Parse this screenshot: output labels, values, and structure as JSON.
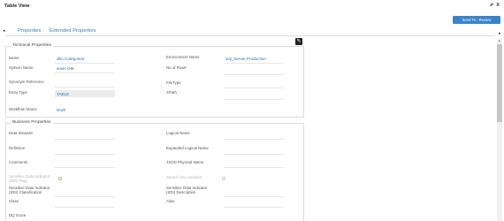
{
  "window": {
    "title": "Table View",
    "maximize_glyph": "⇗",
    "close_glyph": "X"
  },
  "toolbar": {
    "send_label": "Send To - Review"
  },
  "tabs": [
    {
      "label": "Properties",
      "active": true
    },
    {
      "label": "Extended Properties",
      "active": false
    }
  ],
  "icons": {
    "edit": "edit-icon",
    "checkbox_glyph": "✓"
  },
  "technical": {
    "title": "Technical Properties",
    "name_label": "Name",
    "name_value": "dbo.Categories",
    "system_name_label": "System Name",
    "system_name_value": "erwin DM",
    "synonym_label": "Synonym Reference",
    "entry_type_label": "Entry Type",
    "entry_type_value": "TABLE",
    "workflow_label": "Workflow Status",
    "workflow_value": "Draft",
    "env_label": "Environment Name",
    "env_value": "Sql_Server Production",
    "rows_label": "No of Rows",
    "filetype_label": "FileType",
    "xpath_label": "XPath"
  },
  "business": {
    "title": "Business Properties",
    "steward_label": "Data Steward",
    "definition_label": "Definition",
    "comments_label": "Comments",
    "sdi_flag_label": "Sensitive Data Indicator (SDI) Flag",
    "sdi_class_label": "Sensitive Data Indicator (SDI) Classification",
    "class_label": "Class",
    "dq_label": "DQ Score",
    "logical_label": "Logical Name",
    "expanded_label": "Expanded Logical Name",
    "json_label": "JSON Physical Name",
    "search_label": "Search Use Analysis",
    "sdi_desc_label": "Sensitive Data Indicator (SDI) Description",
    "alias_label": "Alias"
  },
  "colors": {
    "accent": "#3b82c8",
    "link": "#2f6fb5"
  }
}
